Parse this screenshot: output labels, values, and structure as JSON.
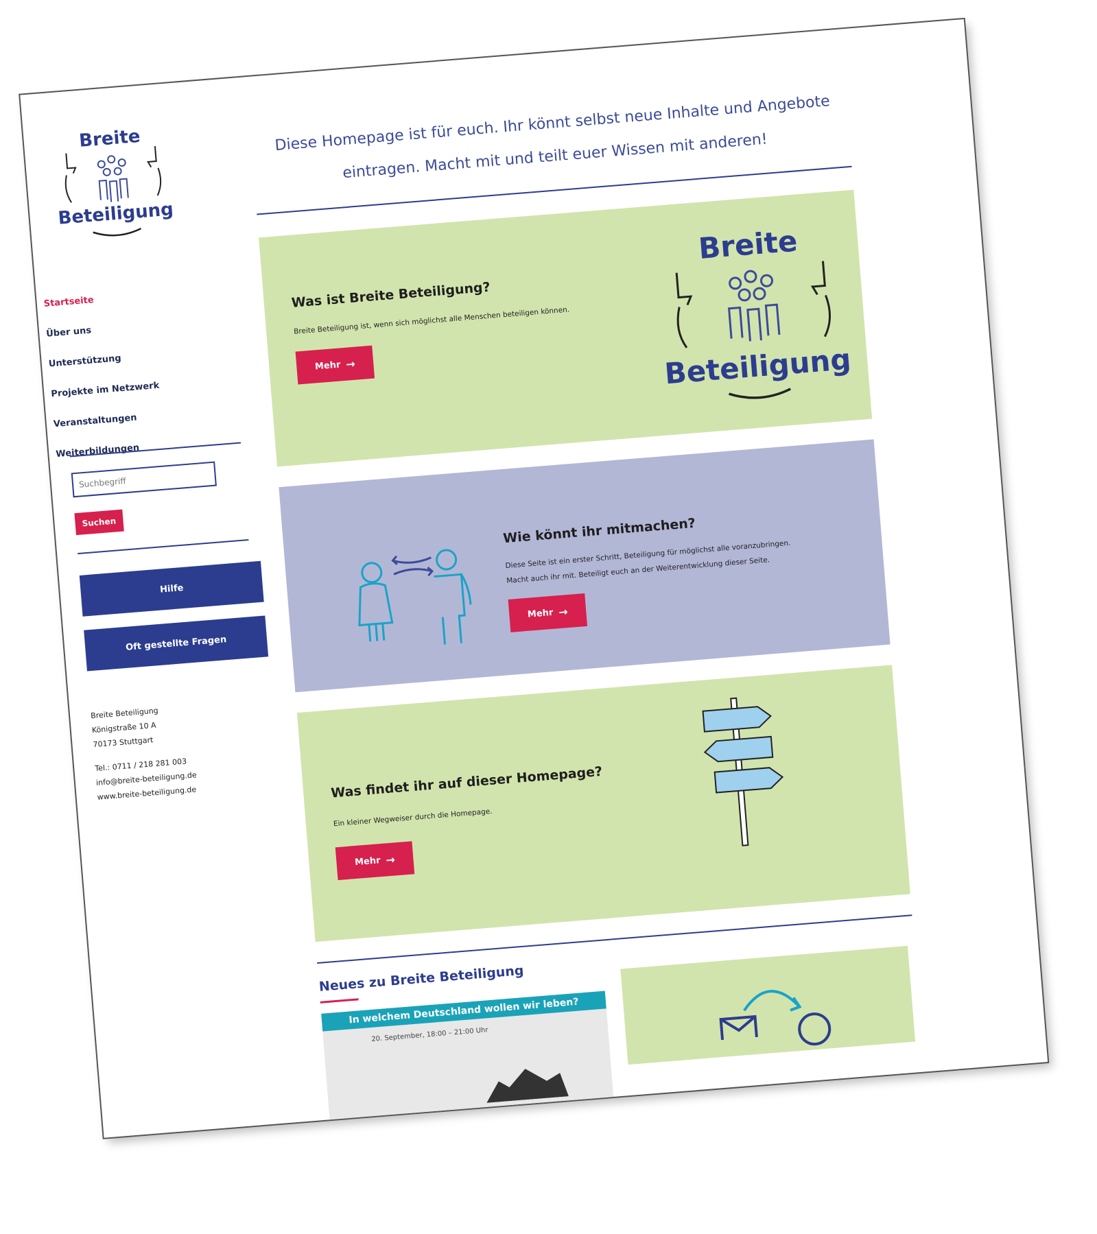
{
  "logo": {
    "line1": "Breite",
    "line2": "Beteiligung"
  },
  "intro": {
    "line1": "Diese Homepage ist für euch. Ihr könnt selbst neue Inhalte und Angebote",
    "line2": "eintragen. Macht mit und teilt euer Wissen mit anderen!"
  },
  "nav": [
    {
      "label": "Startseite"
    },
    {
      "label": "Über uns"
    },
    {
      "label": "Unterstützung"
    },
    {
      "label": "Projekte im Netzwerk"
    },
    {
      "label": "Veranstaltungen"
    },
    {
      "label": "Weiterbildungen"
    }
  ],
  "search": {
    "placeholder": "Suchbegriff",
    "button": "Suchen"
  },
  "side_buttons": {
    "help": "Hilfe",
    "faq": "Oft gestellte Fragen"
  },
  "address": {
    "name": "Breite Beteiligung",
    "street": "Königstraße 10 A",
    "city": "70173 Stuttgart",
    "phone": "Tel.: 0711 / 218 281 003",
    "email": "info@breite-beteiligung.de",
    "web": "www.breite-beteiligung.de"
  },
  "cards": [
    {
      "title": "Was ist Breite Beteiligung?",
      "text": "Breite Beteiligung ist, wenn sich möglichst alle Menschen beteiligen können.",
      "button": "Mehr"
    },
    {
      "title": "Wie könnt ihr mitmachen?",
      "text1": "Diese Seite ist ein erster Schritt, Beteiligung für möglichst alle voranzubringen.",
      "text2": "Macht auch ihr mit. Beteiligt euch an der Weiterentwicklung dieser Seite.",
      "button": "Mehr"
    },
    {
      "title": "Was findet ihr auf dieser Homepage?",
      "text": "Ein kleiner Wegweiser durch die Homepage.",
      "button": "Mehr"
    }
  ],
  "news": {
    "title": "Neues zu Breite Beteiligung",
    "item1": {
      "banner": "In welchem Deutschland wollen wir leben?",
      "date": "20. September, 18:00 – 21:00 Uhr"
    }
  },
  "colors": {
    "accent_red": "#d6204e",
    "navy": "#2c3d8f",
    "green_card": "#d2e4ad",
    "lilac_card": "#b3b7d6",
    "sign_blue": "#9fd0ee"
  },
  "icons": {
    "arrow": "right-arrow-icon",
    "people": "group-people-icon",
    "exchange": "exchange-arrows-icon",
    "signpost": "signpost-icon"
  }
}
